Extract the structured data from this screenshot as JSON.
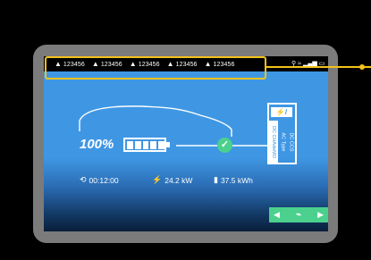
{
  "status_bar": {
    "warnings": [
      {
        "icon": "warning-icon",
        "code": "123456"
      },
      {
        "icon": "warning-icon",
        "code": "123456"
      },
      {
        "icon": "warning-icon",
        "code": "123456"
      },
      {
        "icon": "warning-icon",
        "code": "123456"
      },
      {
        "icon": "warning-icon",
        "code": "123456"
      }
    ],
    "system_icons": [
      "network-icon",
      "wifi-icon",
      "signal-icon",
      "display-icon"
    ]
  },
  "charging": {
    "percent": "100%",
    "battery_level": 1.0,
    "status": "check-icon"
  },
  "metrics": {
    "time": "00:12:00",
    "power": "24.2 kW",
    "energy": "37.5 kWh"
  },
  "connectors": {
    "badge": "⚡/",
    "items": [
      "DC CHAdeMO",
      "AC Type",
      "DC CCS"
    ],
    "active_index": 0
  },
  "nav": {
    "prev": "◀",
    "next": "▶",
    "icon": "plug-icon"
  },
  "colors": {
    "accent": "#4bd18d",
    "screen_blue": "#3f97e4",
    "highlight": "#f3c21b"
  }
}
